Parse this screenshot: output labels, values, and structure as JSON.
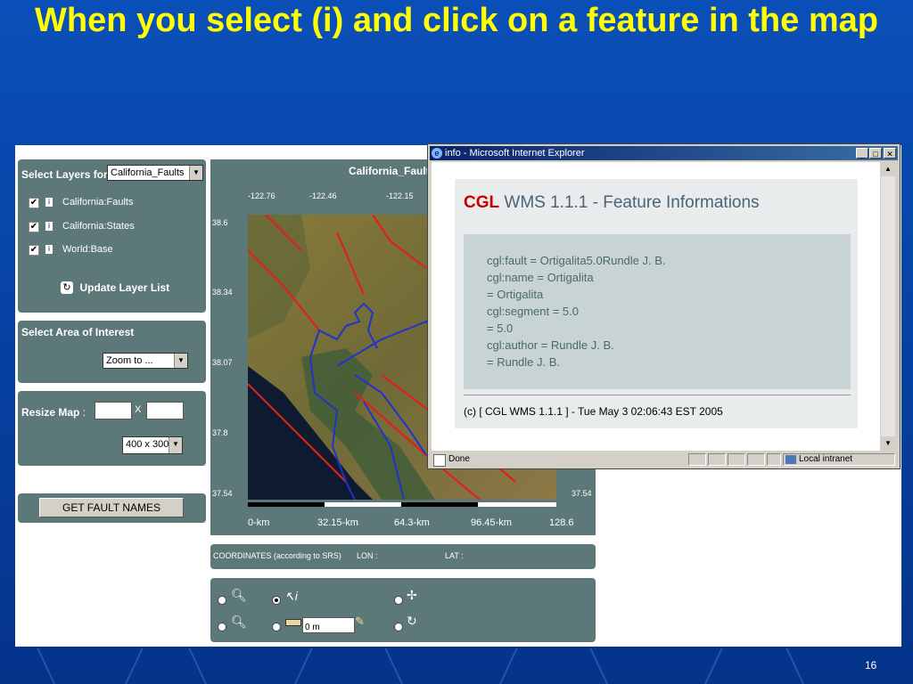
{
  "slide": {
    "title": "When you select (i) and click on a feature in the map",
    "page_number": "16"
  },
  "left_panel": {
    "select_layers_label": "Select Layers for",
    "layer_dropdown_value": "California_Faults",
    "layers": [
      "California:Faults",
      "California:States",
      "World:Base"
    ],
    "update_button": "Update Layer List",
    "area_label": "Select Area of Interest",
    "zoom_dropdown_value": "Zoom to ...",
    "resize_label": "Resize Map",
    "resize_colon": ":",
    "resize_x": "X",
    "size_dropdown_value": "400 x 300",
    "get_fault_names_button": "GET FAULT NAMES"
  },
  "map": {
    "title": "California_Fault",
    "top_ticks": [
      "-122.76",
      "-122.46",
      "-122.15"
    ],
    "left_ticks": [
      "38.6",
      "38.34",
      "38.07",
      "37.8",
      "37.54"
    ],
    "right_tick": "37.54",
    "scale_labels": [
      "0-km",
      "32.15-km",
      "64.3-km",
      "96.45-km",
      "128.6"
    ]
  },
  "coords_bar": {
    "label": "COORDINATES (according to SRS)",
    "lon_label": "LON :",
    "lat_label": "LAT :"
  },
  "toolbar": {
    "distance_value": "0 m",
    "selected_tool": "info"
  },
  "ie_window": {
    "title": "info - Microsoft Internet Explorer",
    "heading_brand": "CGL",
    "heading_rest": "WMS 1.1.1 - Feature Informations",
    "info_lines": [
      "cgl:fault = Ortigalita5.0Rundle J. B.",
      "cgl:name = Ortigalita",
      "= Ortigalita",
      "cgl:segment = 5.0",
      "= 5.0",
      "cgl:author = Rundle J. B.",
      "= Rundle J. B."
    ],
    "footer": "(c) [ CGL WMS 1.1.1 ] - Tue May 3 02:06:43 EST 2005",
    "status_text": "Done",
    "zone_text": "Local intranet"
  },
  "colors": {
    "title_yellow": "#ffff00",
    "panel_bg": "#5d7878",
    "cgl_red": "#cc0000",
    "heading_slate": "#4a6477",
    "info_box": "#c8d4d4",
    "info_text": "#4a6a6a",
    "fault_red": "#e0201c",
    "state_blue": "#2233cc"
  }
}
